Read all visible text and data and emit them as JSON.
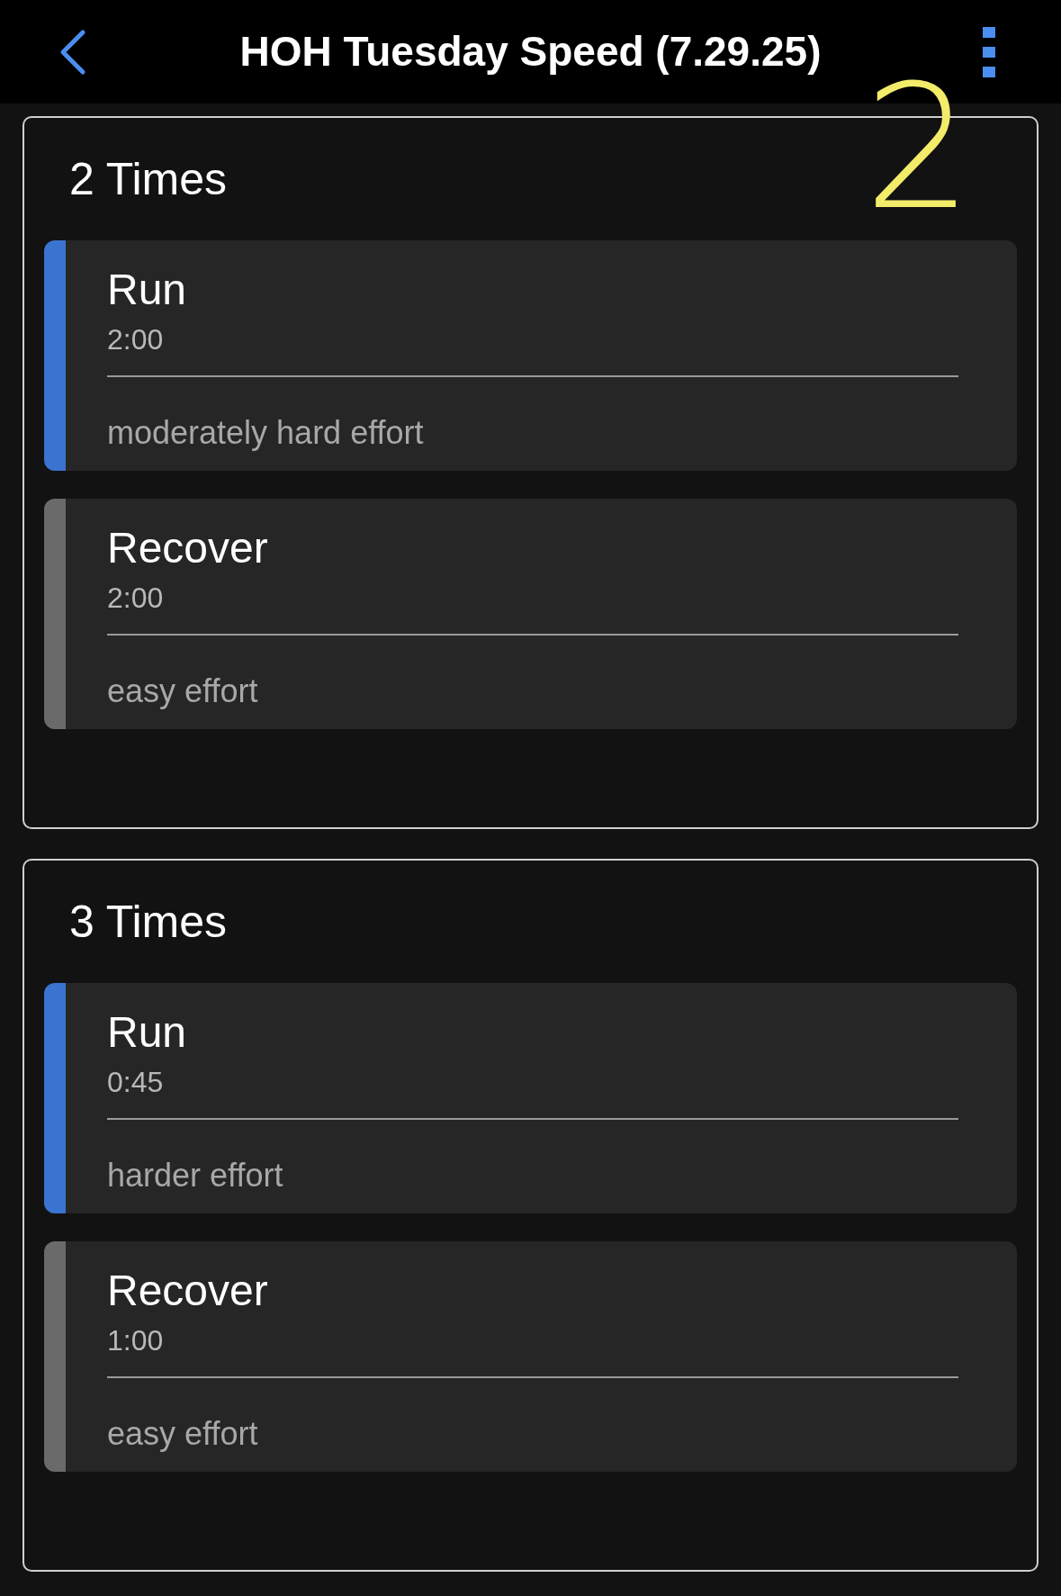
{
  "header": {
    "title": "HOH Tuesday Speed (7.29.25)"
  },
  "annotation": "2",
  "sections": [
    {
      "title": "2 Times",
      "steps": [
        {
          "name": "Run",
          "duration": "2:00",
          "note": "moderately hard effort",
          "color": "#3a74d0"
        },
        {
          "name": "Recover",
          "duration": "2:00",
          "note": "easy effort",
          "color": "#6a6a6a"
        }
      ]
    },
    {
      "title": "3 Times",
      "steps": [
        {
          "name": "Run",
          "duration": "0:45",
          "note": "harder effort",
          "color": "#3a74d0"
        },
        {
          "name": "Recover",
          "duration": "1:00",
          "note": "easy effort",
          "color": "#6a6a6a"
        }
      ]
    }
  ]
}
